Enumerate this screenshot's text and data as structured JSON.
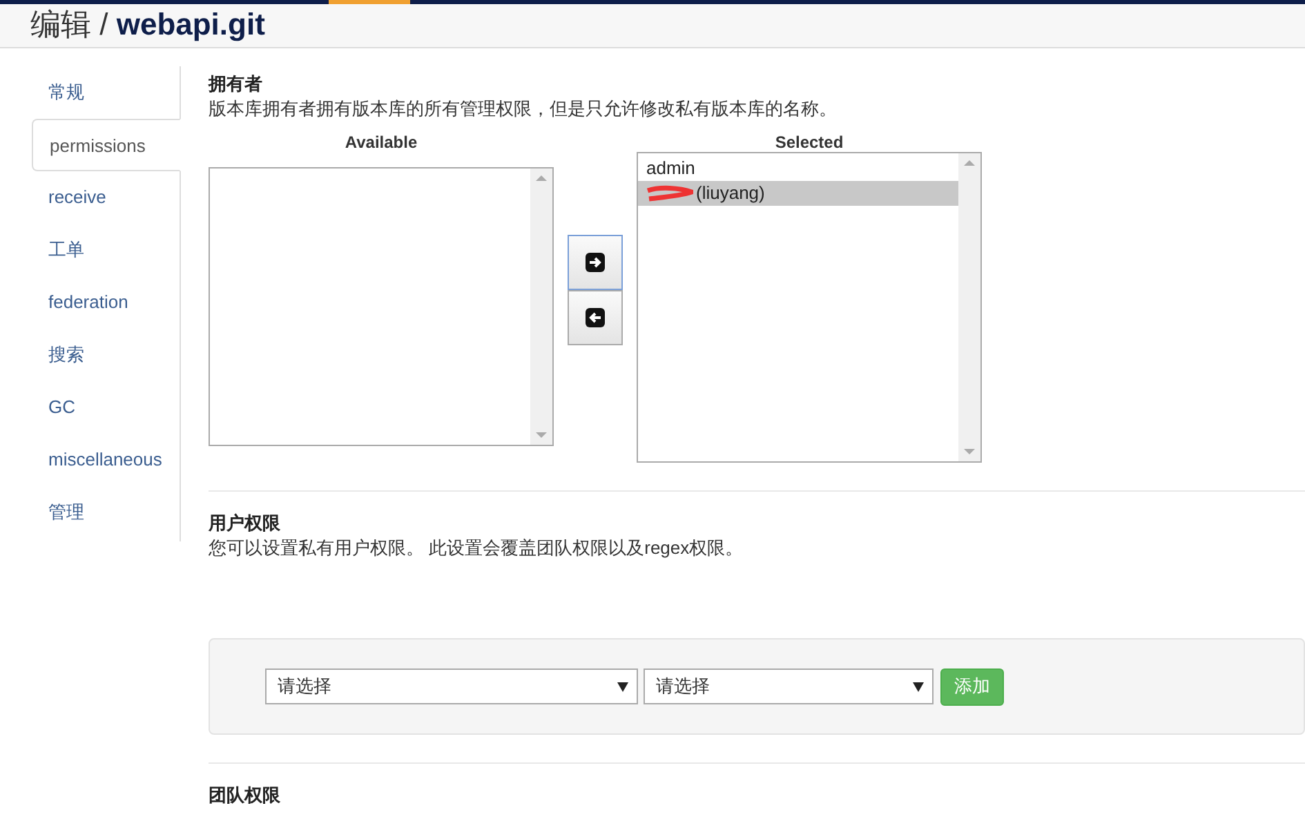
{
  "header": {
    "title_prefix": "编辑 /",
    "title": "webapi.git"
  },
  "sidebar": {
    "items": [
      {
        "label": "常规",
        "selected": false
      },
      {
        "label": "permissions",
        "selected": true
      },
      {
        "label": "receive",
        "selected": false
      },
      {
        "label": "工单",
        "selected": false
      },
      {
        "label": "federation",
        "selected": false
      },
      {
        "label": "搜索",
        "selected": false
      },
      {
        "label": "GC",
        "selected": false
      },
      {
        "label": "miscellaneous",
        "selected": false
      },
      {
        "label": "管理",
        "selected": false
      }
    ]
  },
  "owners": {
    "title": "拥有者",
    "description": "版本库拥有者拥有版本库的所有管理权限，但是只允许修改私有版本库的名称。",
    "available": {
      "heading": "Available"
    },
    "selected_list": {
      "heading": "Selected",
      "items": [
        {
          "label": "admin",
          "selected": false,
          "redacted": false
        },
        {
          "label": "(liuyang)",
          "selected": true,
          "redacted": true
        }
      ]
    }
  },
  "user_permissions": {
    "title": "用户权限",
    "description": "您可以设置私有用户权限。 此设置会覆盖团队权限以及regex权限。",
    "selects": [
      {
        "value": "请选择"
      },
      {
        "value": "请选择"
      }
    ],
    "add_button": "添加"
  },
  "team_permissions": {
    "title": "团队权限"
  }
}
